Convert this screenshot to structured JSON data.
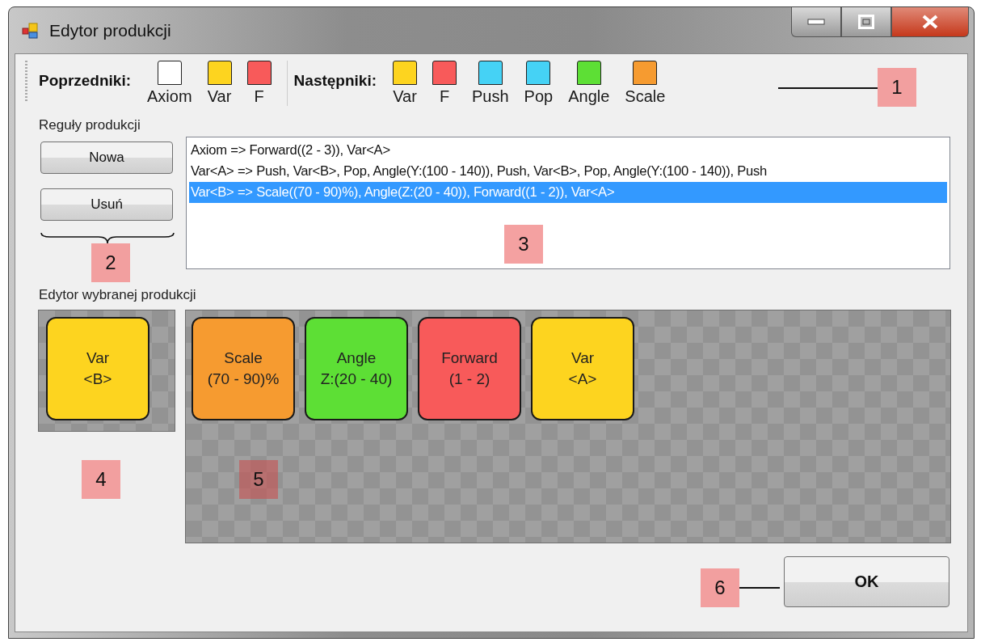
{
  "window": {
    "title": "Edytor produkcji"
  },
  "toolbar": {
    "predecessors_label": "Poprzedniki:",
    "predecessors": [
      {
        "label": "Axiom",
        "color": "#ffffff"
      },
      {
        "label": "Var",
        "color": "#fdd41f"
      },
      {
        "label": "F",
        "color": "#f85a5a"
      }
    ],
    "successors_label": "Następniki:",
    "successors": [
      {
        "label": "Var",
        "color": "#fdd41f"
      },
      {
        "label": "F",
        "color": "#f85a5a"
      },
      {
        "label": "Push",
        "color": "#45d2f5"
      },
      {
        "label": "Pop",
        "color": "#45d2f5"
      },
      {
        "label": "Angle",
        "color": "#5ddf35"
      },
      {
        "label": "Scale",
        "color": "#f69b30"
      }
    ]
  },
  "rules": {
    "label": "Reguły produkcji",
    "buttons": [
      "Nowa",
      "Usuń"
    ],
    "items": [
      {
        "text": "Axiom => Forward((2 - 3)), Var<A>",
        "selected": false
      },
      {
        "text": "Var<A> => Push, Var<B>, Pop, Angle(Y:(100 - 140)), Push, Var<B>, Pop, Angle(Y:(100 - 140)), Push",
        "selected": false
      },
      {
        "text": "Var<B> => Scale((70 - 90)%), Angle(Z:(20 - 40)), Forward((1 - 2)), Var<A>",
        "selected": true
      }
    ]
  },
  "editor": {
    "label": "Edytor wybranej produkcji",
    "predecessor": {
      "text": "Var\n<B>",
      "color": "#fdd41f"
    },
    "successors": [
      {
        "text": "Scale\n(70 - 90)%",
        "color": "#f69b30"
      },
      {
        "text": "Angle\nZ:(20 - 40)",
        "color": "#5ddf35"
      },
      {
        "text": "Forward\n(1 - 2)",
        "color": "#f85a5a"
      },
      {
        "text": "Var\n<A>",
        "color": "#fdd41f"
      }
    ]
  },
  "ok_button": "OK",
  "callouts": [
    "1",
    "2",
    "3",
    "4",
    "5",
    "6"
  ]
}
